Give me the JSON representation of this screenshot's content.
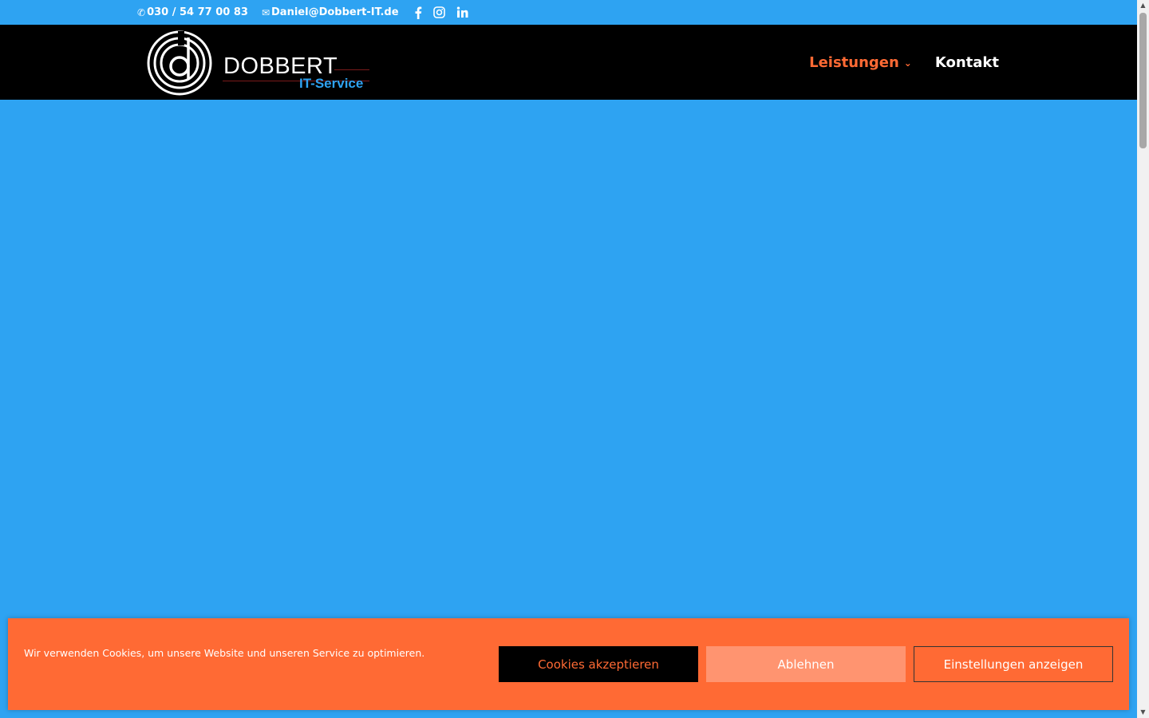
{
  "topbar": {
    "phone": "030 / 54 77 00 83",
    "email": "Daniel@Dobbert-IT.de",
    "social": [
      "facebook-icon",
      "instagram-icon",
      "linkedin-icon"
    ]
  },
  "header": {
    "logo_main": "DOBBERT",
    "logo_sub": "IT-Service",
    "nav": [
      {
        "label": "Leistungen",
        "active": true,
        "has_dropdown": true
      },
      {
        "label": "Kontakt",
        "active": false,
        "has_dropdown": false
      }
    ]
  },
  "cookie_banner": {
    "message": "Wir verwenden Cookies, um unsere Website und unseren Service zu optimieren.",
    "accept_label": "Cookies akzeptieren",
    "deny_label": "Ablehnen",
    "settings_label": "Einstellungen anzeigen"
  },
  "colors": {
    "primary_blue": "#2ea3f2",
    "accent_orange": "#ff6a34",
    "header_black": "#000000"
  }
}
